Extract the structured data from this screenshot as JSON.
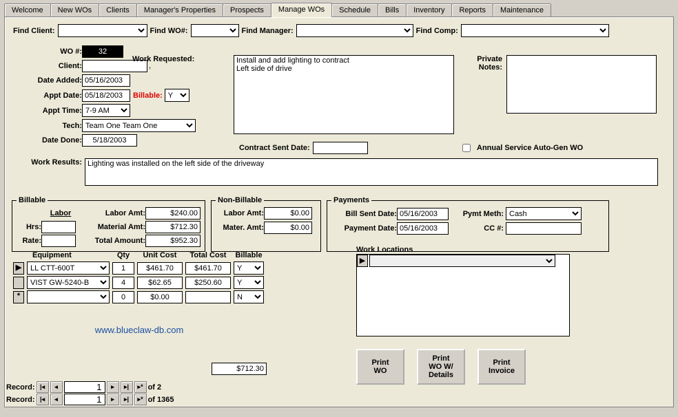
{
  "tabs": [
    "Welcome",
    "New WOs",
    "Clients",
    "Manager's Properties",
    "Prospects",
    "Manage WOs",
    "Schedule",
    "Bills",
    "Inventory",
    "Reports",
    "Maintenance"
  ],
  "active_tab": 5,
  "find": {
    "client_lbl": "Find Client:",
    "wo_lbl": "Find WO#:",
    "manager_lbl": "Find Manager:",
    "comp_lbl": "Find Comp:"
  },
  "form": {
    "wo_num_lbl": "WO #:",
    "wo_num": "32",
    "work_req_lbl": "Work Requested:",
    "work_req": "Install and add lighting to contract\nLeft side of drive",
    "priv_notes_lbl": "Private\nNotes:",
    "priv_notes": "",
    "client_lbl": "Client:",
    "client": "",
    "date_added_lbl": "Date Added:",
    "date_added": "05/16/2003",
    "appt_date_lbl": "Appt Date:",
    "appt_date": "05/18/2003",
    "billable_lbl": "Billable:",
    "billable": "Y",
    "appt_time_lbl": "Appt Time:",
    "appt_time": "7-9 AM",
    "tech_lbl": "Tech:",
    "tech": "Team One Team One",
    "date_done_lbl": "Date Done:",
    "date_done": "5/18/2003",
    "contract_sent_lbl": "Contract Sent Date:",
    "contract_sent": "",
    "auto_gen_lbl": "Annual Service Auto-Gen WO",
    "work_results_lbl": "Work Results:",
    "work_results": "Lighting was installed on the left side of the driveway"
  },
  "billable": {
    "legend": "Billable",
    "labor_u": "Labor",
    "labor_amt_lbl": "Labor Amt:",
    "labor_amt": "$240.00",
    "hrs_lbl": "Hrs:",
    "hrs": "",
    "material_amt_lbl": "Material Amt:",
    "material_amt": "$712.30",
    "rate_lbl": "Rate:",
    "rate": "",
    "total_amt_lbl": "Total Amount:",
    "total_amt": "$952.30"
  },
  "nonbillable": {
    "legend": "Non-Billable",
    "labor_amt_lbl": "Labor Amt:",
    "labor_amt": "$0.00",
    "mater_amt_lbl": "Mater. Amt:",
    "mater_amt": "$0.00"
  },
  "payments": {
    "legend": "Payments",
    "bill_sent_lbl": "Bill Sent Date:",
    "bill_sent": "05/16/2003",
    "pymt_meth_lbl": "Pymt Meth:",
    "pymt_meth": "Cash",
    "payment_date_lbl": "Payment Date:",
    "payment_date": "05/16/2003",
    "cc_lbl": "CC #:",
    "cc": ""
  },
  "equipment": {
    "headers": [
      "Equipment",
      "Qty",
      "Unit Cost",
      "Total Cost",
      "Billable"
    ],
    "rows": [
      {
        "mark": "▶",
        "name": "LL CTT-600T",
        "qty": "1",
        "unit": "$461.70",
        "total": "$461.70",
        "bill": "Y"
      },
      {
        "mark": "",
        "name": "VIST GW-5240-B",
        "qty": "4",
        "unit": "$62.65",
        "total": "$250.60",
        "bill": "Y"
      },
      {
        "mark": "*",
        "name": "",
        "qty": "0",
        "unit": "$0.00",
        "total": "",
        "bill": "N"
      }
    ],
    "sum": "$712.30"
  },
  "workloc_lbl": "Work Locations",
  "buttons": {
    "print_wo": "Print\nWO",
    "print_wo_det": "Print\nWO W/\nDetails",
    "print_inv": "Print\nInvoice"
  },
  "recnav": {
    "label": "Record:",
    "r1_pos": "1",
    "r1_total": "of  2",
    "r2_pos": "1",
    "r2_total": "of  1365"
  },
  "watermark": "www.blueclaw-db.com"
}
